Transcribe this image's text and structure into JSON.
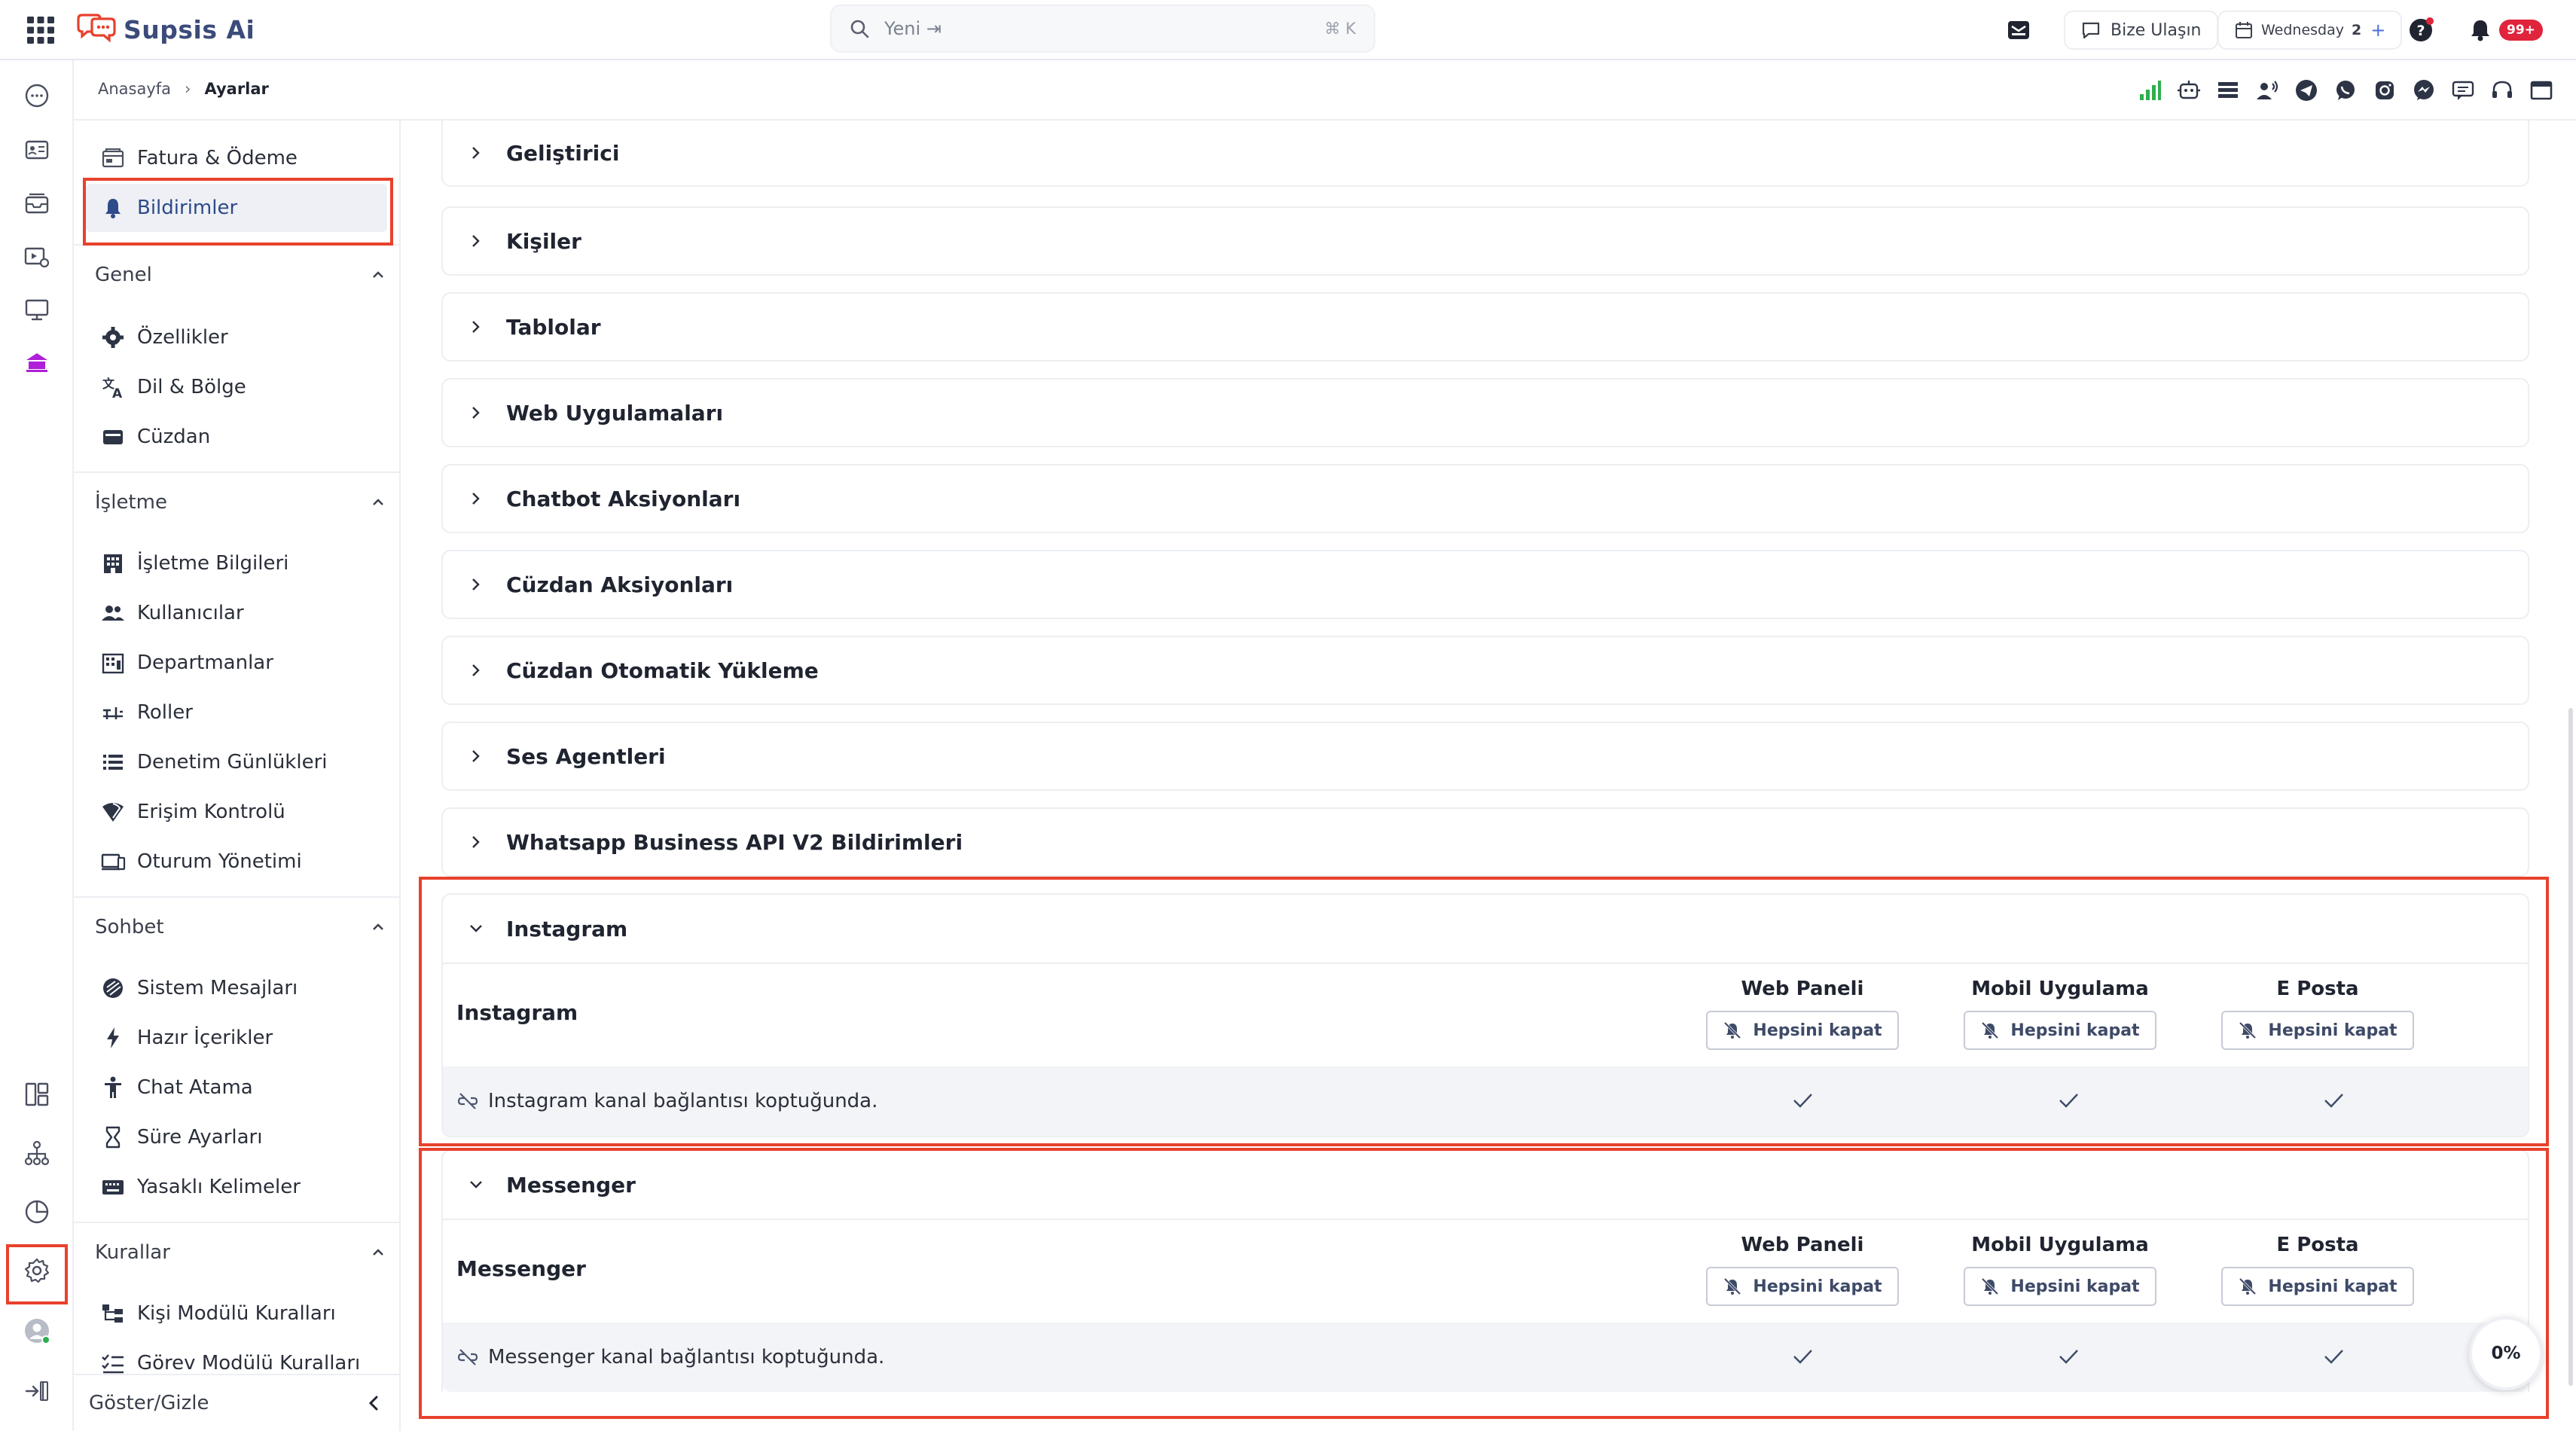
{
  "app": {
    "name": "Supsis Ai"
  },
  "search": {
    "placeholder": "Yeni ⇥",
    "shortcut": "⌘ K"
  },
  "topbar": {
    "contact_label": "Bize Ulaşın",
    "date_label": "Wednesday",
    "date_count": "2",
    "notif_count": "99+"
  },
  "breadcrumb": {
    "home": "Anasayfa",
    "current": "Ayarlar"
  },
  "sidebar": {
    "top_items": [
      {
        "label": "Fatura & Ödeme",
        "icon": "invoice-icon"
      },
      {
        "label": "Bildirimler",
        "icon": "bell-icon",
        "active": true
      }
    ],
    "sections": [
      {
        "title": "Genel",
        "items": [
          {
            "label": "Özellikler",
            "icon": "gear-icon"
          },
          {
            "label": "Dil & Bölge",
            "icon": "translate-icon"
          },
          {
            "label": "Cüzdan",
            "icon": "wallet-icon"
          }
        ]
      },
      {
        "title": "İşletme",
        "items": [
          {
            "label": "İşletme Bilgileri",
            "icon": "building-icon"
          },
          {
            "label": "Kullanıcılar",
            "icon": "users-icon"
          },
          {
            "label": "Departmanlar",
            "icon": "department-icon"
          },
          {
            "label": "Roller",
            "icon": "roles-icon"
          },
          {
            "label": "Denetim Günlükleri",
            "icon": "list-icon"
          },
          {
            "label": "Erişim Kontrolü",
            "icon": "access-icon"
          },
          {
            "label": "Oturum Yönetimi",
            "icon": "session-icon"
          }
        ]
      },
      {
        "title": "Sohbet",
        "items": [
          {
            "label": "Sistem Mesajları",
            "icon": "system-message-icon"
          },
          {
            "label": "Hazır İçerikler",
            "icon": "bolt-icon"
          },
          {
            "label": "Chat Atama",
            "icon": "person-icon"
          },
          {
            "label": "Süre Ayarları",
            "icon": "hourglass-icon"
          },
          {
            "label": "Yasaklı Kelimeler",
            "icon": "keyboard-icon"
          }
        ]
      },
      {
        "title": "Kurallar",
        "items": [
          {
            "label": "Kişi Modülü Kuralları",
            "icon": "tree-icon"
          },
          {
            "label": "Görev Modülü Kuralları",
            "icon": "checklist-icon"
          }
        ]
      }
    ],
    "footer_label": "Göster/Gizle"
  },
  "accordions": [
    "Geliştirici",
    "Kişiler",
    "Tablolar",
    "Web Uygulamaları",
    "Chatbot Aksiyonları",
    "Cüzdan Aksiyonları",
    "Cüzdan Otomatik Yükleme",
    "Ses Agentleri",
    "Whatsapp Business API V2 Bildirimleri"
  ],
  "columns": [
    "Web Paneli",
    "Mobil Uygulama",
    "E Posta"
  ],
  "mute_all_label": "Hepsini kapat",
  "panels": [
    {
      "header": "Instagram",
      "title": "Instagram",
      "row": "Instagram kanal bağlantısı koptuğunda.",
      "checks": [
        true,
        true,
        true
      ]
    },
    {
      "header": "Messenger",
      "title": "Messenger",
      "row": "Messenger kanal bağlantısı koptuğunda.",
      "checks": [
        true,
        true,
        true
      ]
    }
  ],
  "progress": {
    "value": "0%"
  },
  "colors": {
    "brand": "#3b4b7a",
    "logo_red": "#e8412c",
    "highlight": "#e8412c",
    "active_bg": "#eef0f5",
    "active_text": "#2e4a8a",
    "signal_green": "#2fae4e",
    "rail_purple": "#b01fd9",
    "badge_red": "#e0243c"
  }
}
